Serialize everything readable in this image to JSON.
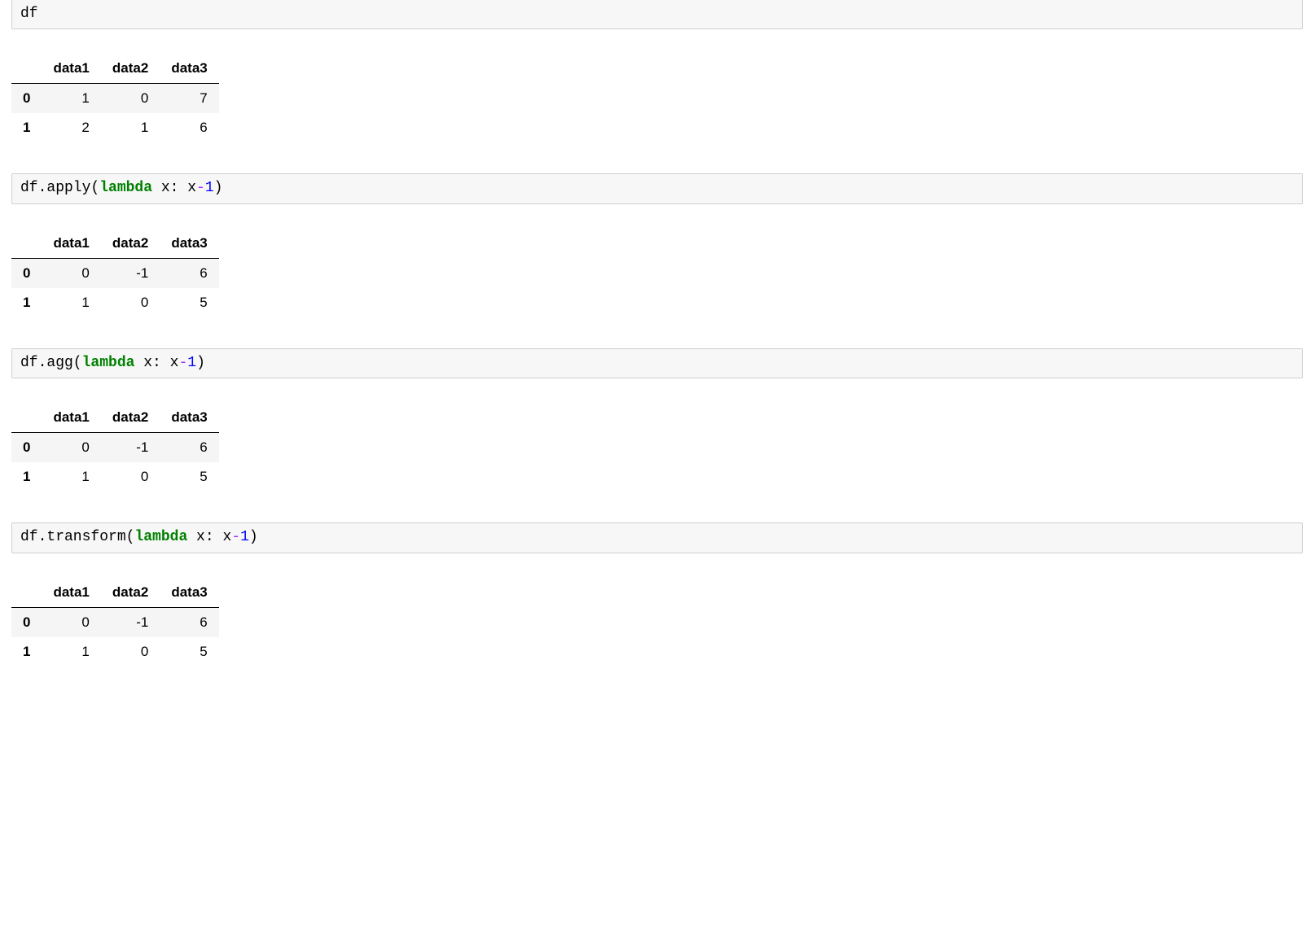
{
  "cells": [
    {
      "code_tokens": [
        {
          "text": "df",
          "class": ""
        }
      ],
      "output_table": {
        "columns": [
          "data1",
          "data2",
          "data3"
        ],
        "index": [
          "0",
          "1"
        ],
        "rows": [
          [
            "1",
            "0",
            "7"
          ],
          [
            "2",
            "1",
            "6"
          ]
        ]
      }
    },
    {
      "code_tokens": [
        {
          "text": "df.apply(",
          "class": ""
        },
        {
          "text": "lambda",
          "class": "kw"
        },
        {
          "text": " x: x",
          "class": ""
        },
        {
          "text": "-",
          "class": "op"
        },
        {
          "text": "1",
          "class": "num"
        },
        {
          "text": ")",
          "class": ""
        }
      ],
      "output_table": {
        "columns": [
          "data1",
          "data2",
          "data3"
        ],
        "index": [
          "0",
          "1"
        ],
        "rows": [
          [
            "0",
            "-1",
            "6"
          ],
          [
            "1",
            "0",
            "5"
          ]
        ]
      }
    },
    {
      "code_tokens": [
        {
          "text": "df.agg(",
          "class": ""
        },
        {
          "text": "lambda",
          "class": "kw"
        },
        {
          "text": " x: x",
          "class": ""
        },
        {
          "text": "-",
          "class": "op"
        },
        {
          "text": "1",
          "class": "num"
        },
        {
          "text": ")",
          "class": ""
        }
      ],
      "output_table": {
        "columns": [
          "data1",
          "data2",
          "data3"
        ],
        "index": [
          "0",
          "1"
        ],
        "rows": [
          [
            "0",
            "-1",
            "6"
          ],
          [
            "1",
            "0",
            "5"
          ]
        ]
      }
    },
    {
      "code_tokens": [
        {
          "text": "df.transform(",
          "class": ""
        },
        {
          "text": "lambda",
          "class": "kw"
        },
        {
          "text": " x: x",
          "class": ""
        },
        {
          "text": "-",
          "class": "op"
        },
        {
          "text": "1",
          "class": "num"
        },
        {
          "text": ")",
          "class": ""
        }
      ],
      "output_table": {
        "columns": [
          "data1",
          "data2",
          "data3"
        ],
        "index": [
          "0",
          "1"
        ],
        "rows": [
          [
            "0",
            "-1",
            "6"
          ],
          [
            "1",
            "0",
            "5"
          ]
        ]
      }
    }
  ]
}
